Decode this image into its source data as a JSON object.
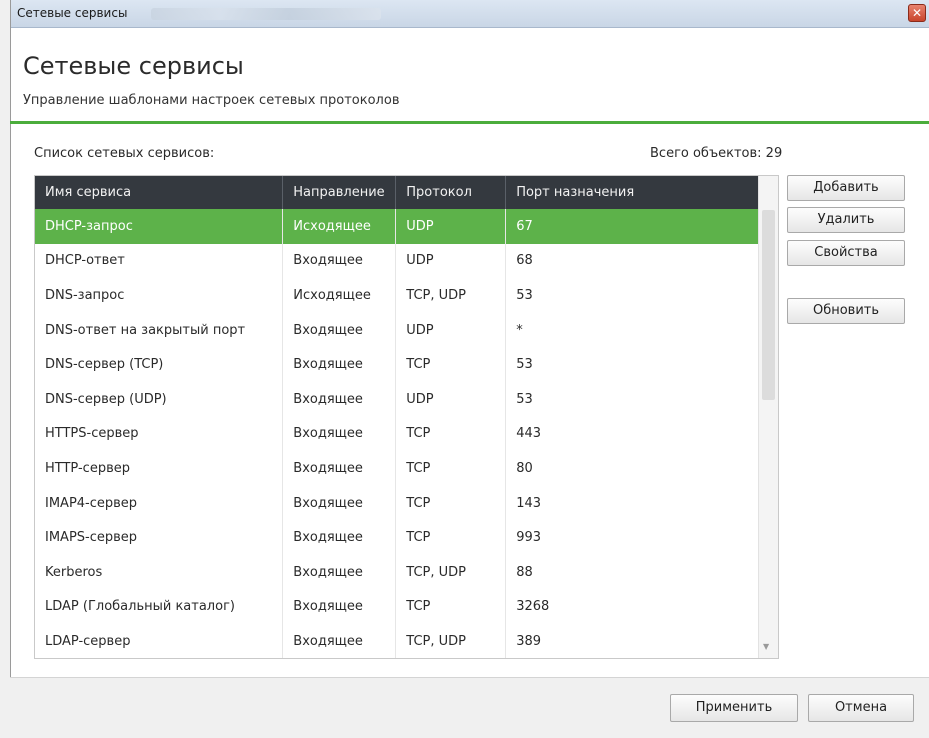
{
  "window": {
    "title": "Сетевые сервисы",
    "close_glyph": "✕"
  },
  "header": {
    "title": "Сетевые сервисы",
    "subtitle": "Управление шаблонами настроек сетевых протоколов"
  },
  "list": {
    "label": "Список сетевых сервисов:",
    "total": "Всего объектов: 29"
  },
  "table": {
    "columns": [
      "Имя сервиса",
      "Направление",
      "Протокол",
      "Порт назначения"
    ],
    "selected_row": 0,
    "rows": [
      [
        "DHCP-запрос",
        "Исходящее",
        "UDP",
        "67"
      ],
      [
        "DHCP-ответ",
        "Входящее",
        "UDP",
        "68"
      ],
      [
        "DNS-запрос",
        "Исходящее",
        "TCP, UDP",
        "53"
      ],
      [
        "DNS-ответ на закрытый порт",
        "Входящее",
        "UDP",
        "*"
      ],
      [
        "DNS-сервер (TCP)",
        "Входящее",
        "TCP",
        "53"
      ],
      [
        "DNS-сервер (UDP)",
        "Входящее",
        "UDP",
        "53"
      ],
      [
        "HTTPS-сервер",
        "Входящее",
        "TCP",
        "443"
      ],
      [
        "HTTP-сервер",
        "Входящее",
        "TCP",
        "80"
      ],
      [
        "IMAP4-сервер",
        "Входящее",
        "TCP",
        "143"
      ],
      [
        "IMAPS-сервер",
        "Входящее",
        "TCP",
        "993"
      ],
      [
        "Kerberos",
        "Входящее",
        "TCP, UDP",
        "88"
      ],
      [
        "LDAP (Глобальный каталог)",
        "Входящее",
        "TCP",
        "3268"
      ],
      [
        "LDAP-сервер",
        "Входящее",
        "TCP, UDP",
        "389"
      ]
    ]
  },
  "side_buttons": {
    "add": "Добавить",
    "delete": "Удалить",
    "properties": "Свойства",
    "refresh": "Обновить"
  },
  "footer": {
    "apply": "Применить",
    "cancel": "Отмена"
  },
  "colors": {
    "accent": "#4bad3c",
    "selected_row": "#5db24a",
    "header_bg": "#34393f"
  }
}
